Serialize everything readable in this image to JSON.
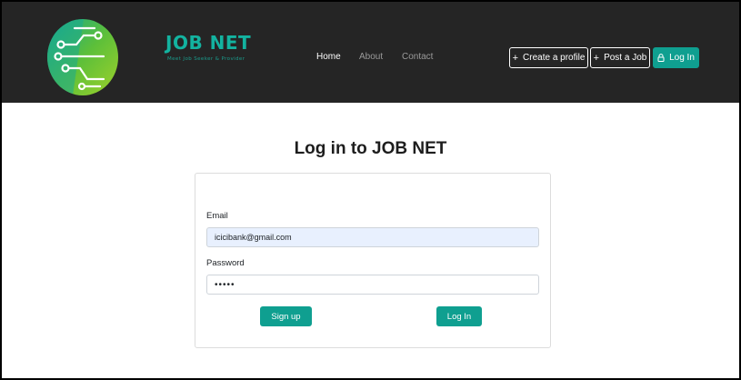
{
  "header": {
    "brand_title": "JOB NET",
    "brand_subtitle": "Meet Job Seeker & Provider",
    "nav": [
      {
        "label": "Home",
        "active": true
      },
      {
        "label": "About",
        "active": false
      },
      {
        "label": "Contact",
        "active": false
      }
    ],
    "create_profile_label": "Create a profile",
    "post_job_label": "Post a Job",
    "login_label": "Log In",
    "plus_icon": "+",
    "lock_icon": "lock-icon"
  },
  "main": {
    "title": "Log in to JOB NET",
    "email_label": "Email",
    "email_value": "icicibank@gmail.com",
    "password_label": "Password",
    "password_value": "•••••",
    "signup_button": "Sign up",
    "login_button": "Log In"
  },
  "colors": {
    "accent": "#0f9f90",
    "navbar_bg": "#252525",
    "brand_text": "#13b3a0",
    "autofill_bg": "#e8f0fe"
  }
}
